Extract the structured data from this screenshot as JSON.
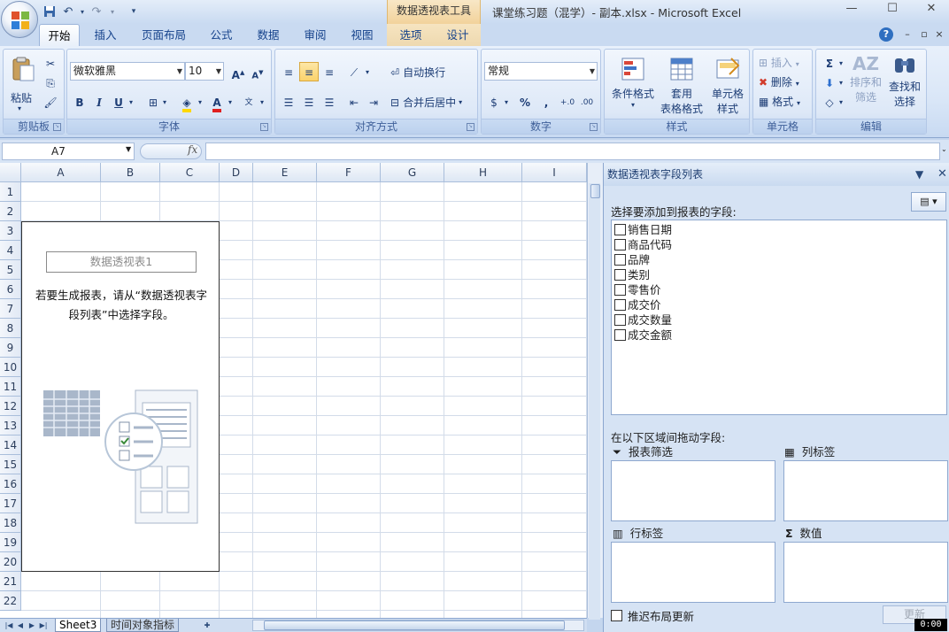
{
  "titlebar": {
    "context_tab": "数据透视表工具",
    "window_title": "课堂练习题（混学）- 副本.xlsx - Microsoft Excel",
    "minimize": "—",
    "maximize": "☐",
    "close": "✕"
  },
  "tabs": [
    "开始",
    "插入",
    "页面布局",
    "公式",
    "数据",
    "审阅",
    "视图",
    "选项",
    "设计"
  ],
  "ribbon": {
    "clipboard": {
      "label": "剪贴板",
      "paste": "粘贴"
    },
    "font": {
      "label": "字体",
      "font_name": "微软雅黑",
      "font_size": "10"
    },
    "alignment": {
      "label": "对齐方式",
      "wrap": "自动换行",
      "merge": "合并后居中"
    },
    "number": {
      "label": "数字",
      "format": "常规"
    },
    "styles": {
      "label": "样式",
      "cond_format": "条件格式",
      "table_format_1": "套用",
      "table_format_2": "表格格式",
      "cell_style_1": "单元格",
      "cell_style_2": "样式"
    },
    "cells": {
      "label": "单元格",
      "insert": "插入",
      "delete": "删除",
      "format": "格式"
    },
    "editing": {
      "label": "编辑",
      "sort_1": "排序和",
      "sort_2": "筛选",
      "find_1": "查找和",
      "find_2": "选择"
    }
  },
  "formula_bar": {
    "name_box": "A7",
    "fx": "fx",
    "content": ""
  },
  "grid": {
    "columns": [
      "A",
      "B",
      "C",
      "D",
      "E",
      "F",
      "G",
      "H",
      "I"
    ],
    "rows": [
      "1",
      "2",
      "3",
      "4",
      "5",
      "6",
      "7",
      "8",
      "9",
      "10",
      "11",
      "12",
      "13",
      "14",
      "15",
      "16",
      "17",
      "18",
      "19",
      "20",
      "21",
      "22"
    ]
  },
  "pivot": {
    "name": "数据透视表1",
    "hint_line1": "若要生成报表，请从“数据透视表字",
    "hint_line2": "段列表”中选择字段。"
  },
  "sheets": {
    "active": "Sheet3",
    "other": "时间对象指标"
  },
  "field_pane": {
    "title": "数据透视表字段列表",
    "choose_label": "选择要添加到报表的字段:",
    "fields": [
      "销售日期",
      "商品代码",
      "品牌",
      "类别",
      "零售价",
      "成交价",
      "成交数量",
      "成交金额"
    ],
    "drag_label": "在以下区域间拖动字段:",
    "areas": {
      "filter": "报表筛选",
      "columns": "列标签",
      "rows": "行标签",
      "values": "数值"
    },
    "defer_label": "推迟布局更新",
    "update_button": "更新"
  },
  "clock": "0:00",
  "colors": {
    "accent": "#15428b",
    "ribbon": "#dde8f7",
    "context": "#f2d29b"
  }
}
